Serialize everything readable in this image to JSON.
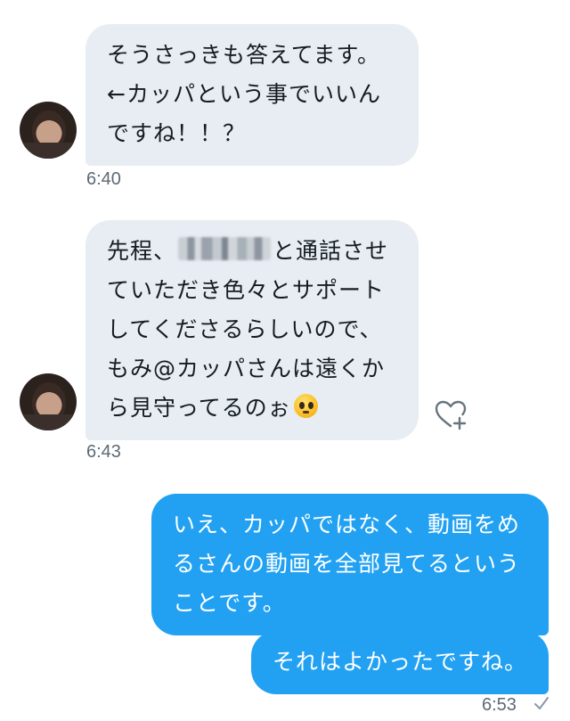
{
  "messages": [
    {
      "direction": "incoming",
      "lines": [
        "そうさっきも答えてます。",
        "←カッパという事でいいん",
        "ですね！！？"
      ],
      "time": "6:40"
    },
    {
      "direction": "incoming",
      "line1_prefix": "先程、",
      "line1_suffix": "と通話させ",
      "lines_rest": [
        "ていただき色々とサポート",
        "してくださるらしいので、",
        "もみ@カッパさんは遠くか"
      ],
      "line5_text": "ら見守ってるのぉ",
      "emoji": "pleading-face",
      "time": "6:43"
    },
    {
      "direction": "outgoing",
      "lines": [
        "いえ、カッパではなく、動画をめ",
        "るさんの動画を全部見てるという",
        "ことです。"
      ]
    },
    {
      "direction": "outgoing",
      "lines": [
        "それはよかったですね。"
      ],
      "time": "6:53",
      "status_icon": "sent-check-icon"
    }
  ],
  "actions": {
    "like_icon": "heart-plus-icon"
  },
  "colors": {
    "incoming_bubble": "#e7edf2",
    "outgoing_bubble": "#22a1f2",
    "timestamp": "#5c6a76"
  }
}
